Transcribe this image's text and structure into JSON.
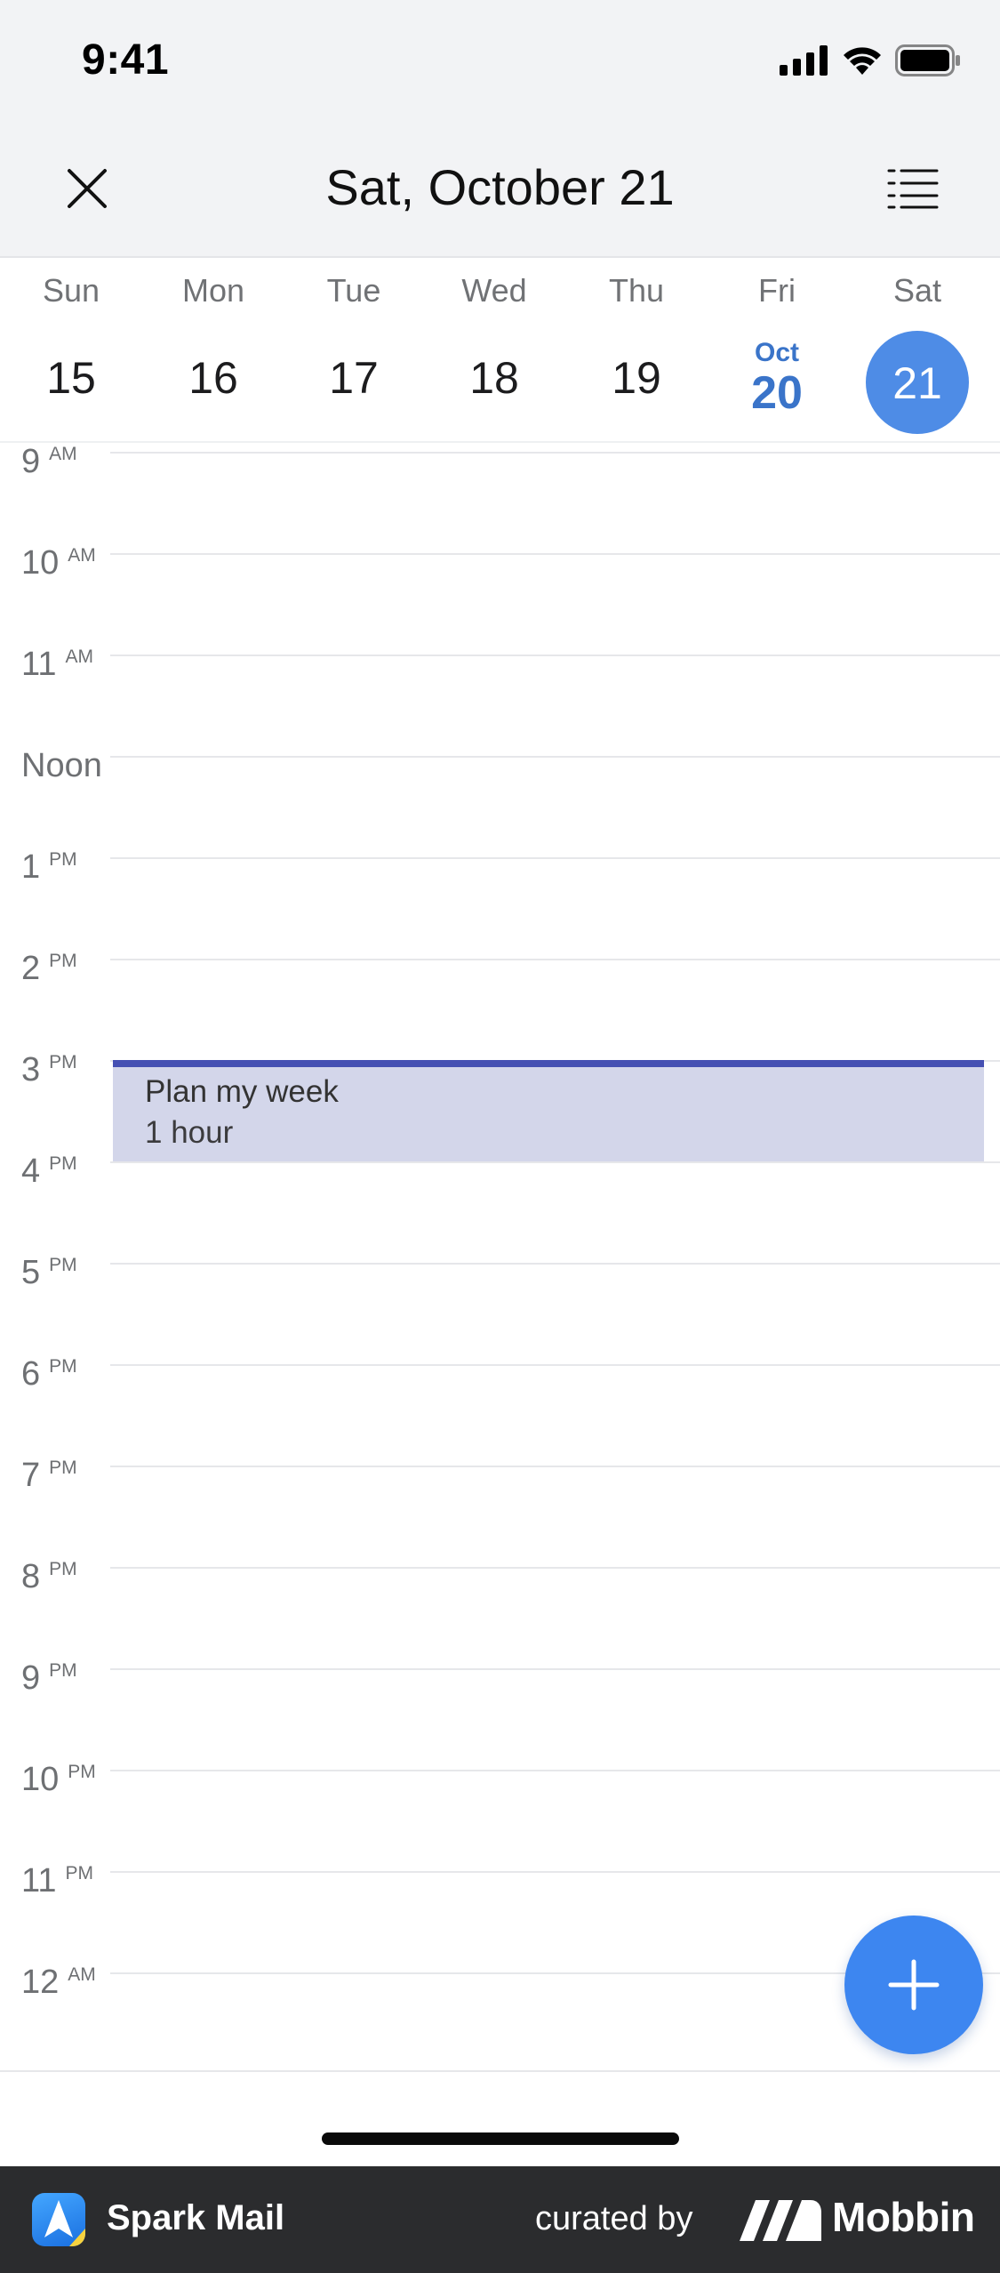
{
  "status_bar": {
    "time": "9:41"
  },
  "nav": {
    "title": "Sat, October 21"
  },
  "week": {
    "days": [
      {
        "name": "Sun",
        "num": "15"
      },
      {
        "name": "Mon",
        "num": "16"
      },
      {
        "name": "Tue",
        "num": "17"
      },
      {
        "name": "Wed",
        "num": "18"
      },
      {
        "name": "Thu",
        "num": "19"
      },
      {
        "name": "Fri",
        "month": "Oct",
        "num": "20"
      },
      {
        "name": "Sat",
        "num": "21"
      }
    ]
  },
  "timeline": {
    "hours": [
      {
        "num": "9",
        "ampm": "AM"
      },
      {
        "num": "10",
        "ampm": "AM"
      },
      {
        "num": "11",
        "ampm": "AM"
      },
      {
        "num": "Noon",
        "ampm": ""
      },
      {
        "num": "1",
        "ampm": "PM"
      },
      {
        "num": "2",
        "ampm": "PM"
      },
      {
        "num": "3",
        "ampm": "PM"
      },
      {
        "num": "4",
        "ampm": "PM"
      },
      {
        "num": "5",
        "ampm": "PM"
      },
      {
        "num": "6",
        "ampm": "PM"
      },
      {
        "num": "7",
        "ampm": "PM"
      },
      {
        "num": "8",
        "ampm": "PM"
      },
      {
        "num": "9",
        "ampm": "PM"
      },
      {
        "num": "10",
        "ampm": "PM"
      },
      {
        "num": "11",
        "ampm": "PM"
      },
      {
        "num": "12",
        "ampm": "AM"
      }
    ]
  },
  "event": {
    "title": "Plan my week",
    "duration": "1 hour"
  },
  "footer": {
    "app_name": "Spark Mail",
    "curated_by": "curated by",
    "brand": "Mobbin"
  },
  "colors": {
    "accent": "#3d86f0",
    "today": "#3a74c9",
    "event_bg": "#d3d6ea",
    "event_bar": "#4550b3"
  }
}
